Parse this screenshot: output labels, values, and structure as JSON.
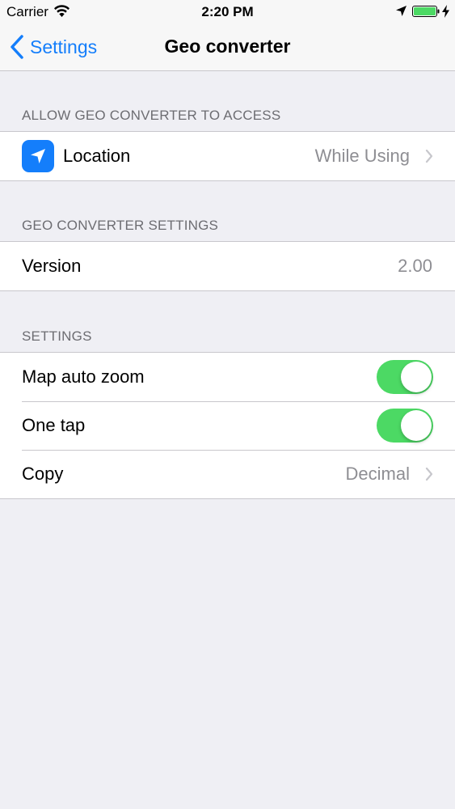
{
  "status_bar": {
    "carrier": "Carrier",
    "time": "2:20 PM",
    "battery_level": 1.0,
    "battery_color": "#4cd964"
  },
  "nav": {
    "back_label": "Settings",
    "title": "Geo converter",
    "accent_color": "#147efb"
  },
  "sections": {
    "access": {
      "header": "ALLOW GEO CONVERTER TO ACCESS",
      "rows": [
        {
          "icon": "location-arrow-icon",
          "label": "Location",
          "value": "While Using"
        }
      ]
    },
    "app_settings": {
      "header": "GEO CONVERTER SETTINGS",
      "rows": [
        {
          "label": "Version",
          "value": "2.00"
        }
      ]
    },
    "settings": {
      "header": "SETTINGS",
      "rows": [
        {
          "label": "Map auto zoom",
          "toggle_on": true
        },
        {
          "label": "One tap",
          "toggle_on": true
        },
        {
          "label": "Copy",
          "value": "Decimal"
        }
      ]
    }
  }
}
